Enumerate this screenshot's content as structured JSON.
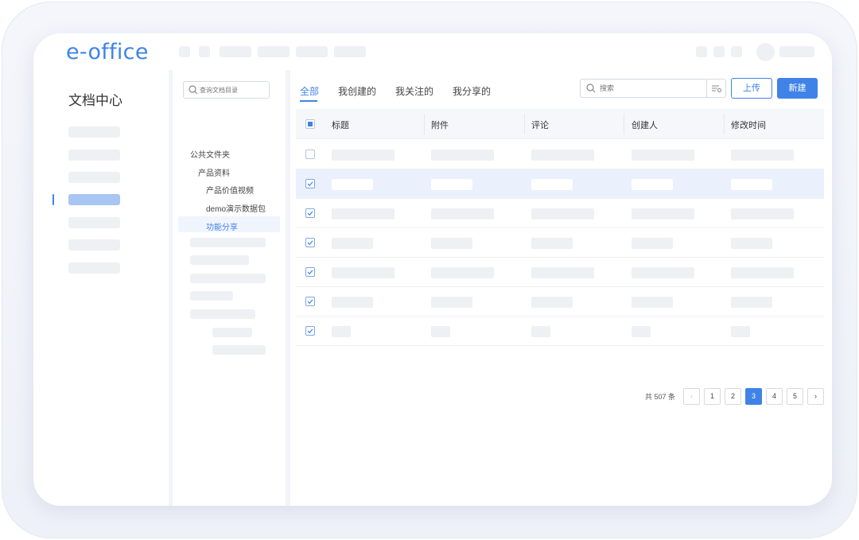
{
  "app": {
    "logo": "e-office",
    "section_title": "文档中心"
  },
  "tree": {
    "search_placeholder": "查询文档目录",
    "items": [
      "公共文件夹",
      "产品资料",
      "产品价值视频",
      "demo演示数据包",
      "功能分享"
    ],
    "selected_index": 4
  },
  "tabs": [
    "全部",
    "我创建的",
    "我关注的",
    "我分享的"
  ],
  "active_tab": 0,
  "toolbar": {
    "search_placeholder": "搜索",
    "upload_label": "上传",
    "new_label": "新建"
  },
  "table": {
    "columns": [
      "标题",
      "附件",
      "评论",
      "创建人",
      "修改时间"
    ],
    "rows": [
      {
        "checked": false,
        "selected": false
      },
      {
        "checked": true,
        "selected": true
      },
      {
        "checked": true,
        "selected": false
      },
      {
        "checked": true,
        "selected": false
      },
      {
        "checked": true,
        "selected": false
      },
      {
        "checked": true,
        "selected": false
      },
      {
        "checked": true,
        "selected": false
      }
    ]
  },
  "pagination": {
    "total_text": "共 507 条",
    "pages": [
      "1",
      "2",
      "3",
      "4",
      "5"
    ],
    "current": "3",
    "prev": "‹",
    "next": "›"
  },
  "colors": {
    "accent": "#3f83e8",
    "selected_row": "#eaf0fc",
    "placeholder": "#eef0f4"
  }
}
